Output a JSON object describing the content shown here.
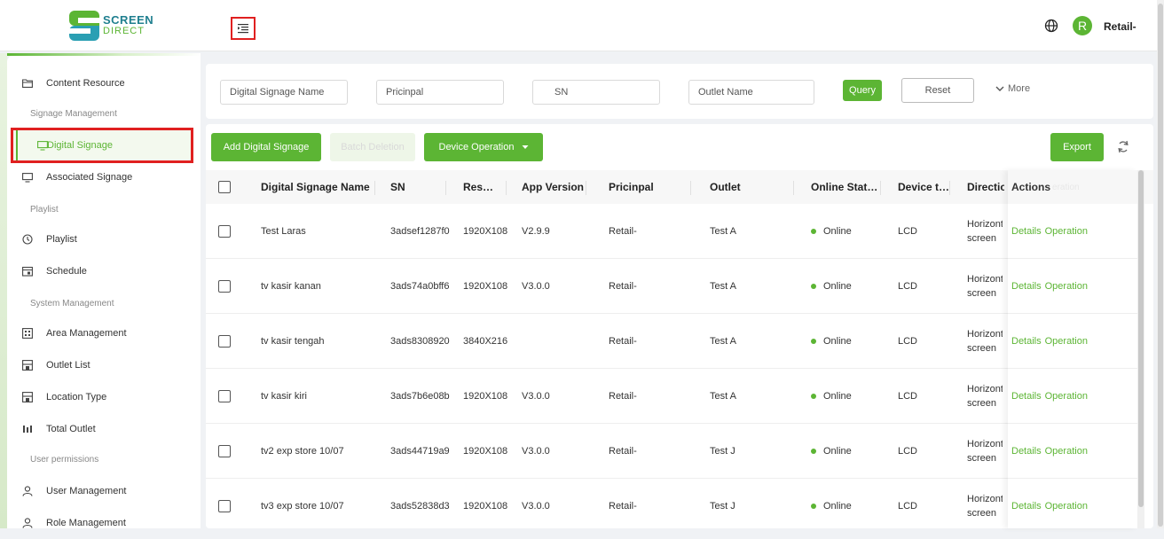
{
  "brand": {
    "line1": "SCREEN",
    "line2": "DIRECT"
  },
  "header": {
    "username": "Retail-",
    "avatar_letter": "R"
  },
  "sidebar": {
    "items": [
      {
        "label": "Content Resource",
        "icon": "folder-icon"
      },
      {
        "section": "Signage Management"
      },
      {
        "label": "Digital Signage",
        "icon": "monitor-icon",
        "active": true
      },
      {
        "label": "Associated Signage",
        "icon": "monitor-icon"
      },
      {
        "section": "Playlist"
      },
      {
        "label": "Playlist",
        "icon": "clock-icon"
      },
      {
        "label": "Schedule",
        "icon": "calendar-icon"
      },
      {
        "section": "System Management"
      },
      {
        "label": "Area Management",
        "icon": "building-icon"
      },
      {
        "label": "Outlet List",
        "icon": "store-icon"
      },
      {
        "label": "Location Type",
        "icon": "store-icon"
      },
      {
        "label": "Total Outlet",
        "icon": "stats-icon"
      },
      {
        "section": "User permissions"
      },
      {
        "label": "User Management",
        "icon": "user-icon"
      },
      {
        "label": "Role Management",
        "icon": "user-icon"
      }
    ]
  },
  "filters": {
    "name_placeholder": "Digital Signage Name",
    "principal_placeholder": "Pricinpal",
    "sn_placeholder": "SN",
    "outlet_placeholder": "Outlet Name",
    "query_label": "Query",
    "reset_label": "Reset",
    "more_label": "More"
  },
  "toolbar": {
    "add_label": "Add Digital Signage",
    "batch_label": "Batch Deletion",
    "device_label": "Device Operation",
    "export_label": "Export"
  },
  "table": {
    "headers": {
      "name": "Digital Signage Name",
      "sn": "SN",
      "res": "Res…",
      "app": "App Version",
      "principal": "Pricinpal",
      "outlet": "Outlet",
      "status": "Online Stat…",
      "device": "Device t…",
      "direction": "Directio",
      "actions": "Actions",
      "operation_ghost": "eration"
    },
    "rows": [
      {
        "name": "Test Laras",
        "sn": "3adsef1287f0",
        "res": "1920X108",
        "app": "V2.9.9",
        "principal": "Retail-",
        "outlet": "Test A",
        "status": "Online",
        "device": "LCD",
        "dir1": "Horizont",
        "dir2": "screen",
        "details": "Details",
        "operation": "Operation"
      },
      {
        "name": "tv kasir kanan",
        "sn": "3ads74a0bff6",
        "res": "1920X108",
        "app": "V3.0.0",
        "principal": "Retail-",
        "outlet": "Test A",
        "status": "Online",
        "device": "LCD",
        "dir1": "Horizont",
        "dir2": "screen",
        "details": "Details",
        "operation": "Operation"
      },
      {
        "name": "tv kasir tengah",
        "sn": "3ads8308920",
        "res": "3840X216",
        "app": "",
        "principal": "Retail-",
        "outlet": "Test A",
        "status": "Online",
        "device": "LCD",
        "dir1": "Horizont",
        "dir2": "screen",
        "details": "Details",
        "operation": "Operation"
      },
      {
        "name": "tv kasir kiri",
        "sn": "3ads7b6e08b",
        "res": "1920X108",
        "app": "V3.0.0",
        "principal": "Retail-",
        "outlet": "Test A",
        "status": "Online",
        "device": "LCD",
        "dir1": "Horizont",
        "dir2": "screen",
        "details": "Details",
        "operation": "Operation"
      },
      {
        "name": "tv2 exp store 10/07",
        "sn": "3ads44719a9",
        "res": "1920X108",
        "app": "V3.0.0",
        "principal": "Retail-",
        "outlet": "Test J",
        "status": "Online",
        "device": "LCD",
        "dir1": "Horizont",
        "dir2": "screen",
        "details": "Details",
        "operation": "Operation"
      },
      {
        "name": "tv3 exp store 10/07",
        "sn": "3ads52838d3",
        "res": "1920X108",
        "app": "V3.0.0",
        "principal": "Retail-",
        "outlet": "Test J",
        "status": "Online",
        "device": "LCD",
        "dir1": "Horizont",
        "dir2": "screen",
        "details": "Details",
        "operation": "Operation"
      }
    ]
  },
  "colors": {
    "accent": "#5cb534",
    "highlight": "#e02020"
  }
}
